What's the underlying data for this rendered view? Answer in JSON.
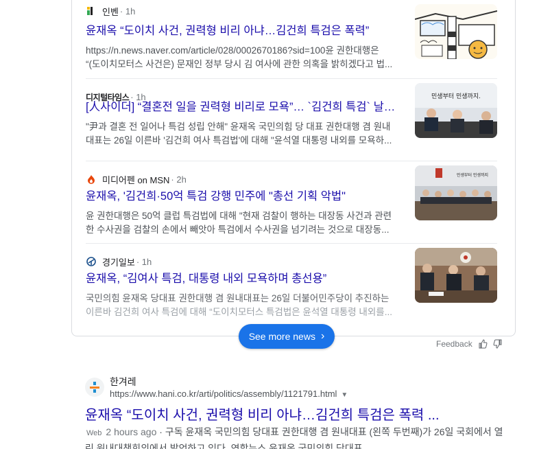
{
  "news": {
    "articles": [
      {
        "source": "인벤",
        "time": "· 1h",
        "headline": "윤재옥 “도이치 사건, 권력형 비리 아냐…김건희 특검은 폭력”",
        "snippet": [
          "https://n.news.naver.com/article/028/0002670186?sid=100윤 권한대행은",
          "“(도이치모터스 사건은) 문재인 정부 당시 김 여사에 관한 의혹을 밝히겠다고 법..."
        ],
        "icon": "inven-icon"
      },
      {
        "source": "디지털타임스",
        "time": "· 1h",
        "headline": "[人사이더] “결혼전 일을 권력형 비리로 모욕”… `김건희 특검` 날세운...",
        "snippet": [
          "\"尹과 결혼 전 일어나 특검 성립 안해\" 윤재옥 국민의힘 당 대표 권한대행 겸 원내",
          "대표는 26일 이른바 '김건희 여사 특검법'에 대해 \"윤석열 대통령 내외를 모욕하..."
        ],
        "thumb_text": "민생부터 민생까지."
      },
      {
        "source": "미디어펜 on MSN",
        "time": "· 2h",
        "headline": "윤재옥, '김건희·50억 특검 강행 민주에 \"총선 기획 악법\"",
        "snippet": [
          "윤 권한대행은 50억 클럽 특검법에 대해 \"현재 검찰이 행하는 대장동 사건과 관련",
          "한 수사권을 검찰의 손에서 빼앗아 특검에서 수사권을 넘기려는 것으로 대장동..."
        ],
        "icon": "flame-icon",
        "thumb_text": "민생부터 민생까지"
      },
      {
        "source": "경기일보",
        "time": "· 1h",
        "headline": "윤재옥, “김여사 특검, 대통령 내외 모욕하며 총선용”",
        "snippet": [
          "국민의힘 윤재옥 당대표 권한대행 겸 원내대표는 26일 더불어민주당이 추진하는",
          "이른바 김건희 여사 특검에 대해 “도이치모터스 특검법은 윤석열 대통령 내외를..."
        ],
        "icon": "kyeonggi-icon"
      }
    ],
    "see_more": "See more news",
    "feedback": "Feedback"
  },
  "result": {
    "site": "한겨레",
    "url": "https://www.hani.co.kr/arti/politics/assembly/1121791.html",
    "title": "윤재옥 “도이치 사건, 권력형 비리 아냐…김건희 특검은 폭력 ...",
    "badge": "Web",
    "date": "2 hours ago",
    "snippet_rest": " · 구독 윤재옥 국민의힘 당대표 권한대행 겸 원내대표 (왼쪽 두번째)가 26일 국회에서 열",
    "snippet_line2": "린 원내대책회의에서 발언하고 있다. 연합뉴스 윤재옥 국민의힘 당대표 ..."
  },
  "colors": {
    "link": "#1a0dab",
    "button": "#1a73e8",
    "text": "#4d5156"
  }
}
